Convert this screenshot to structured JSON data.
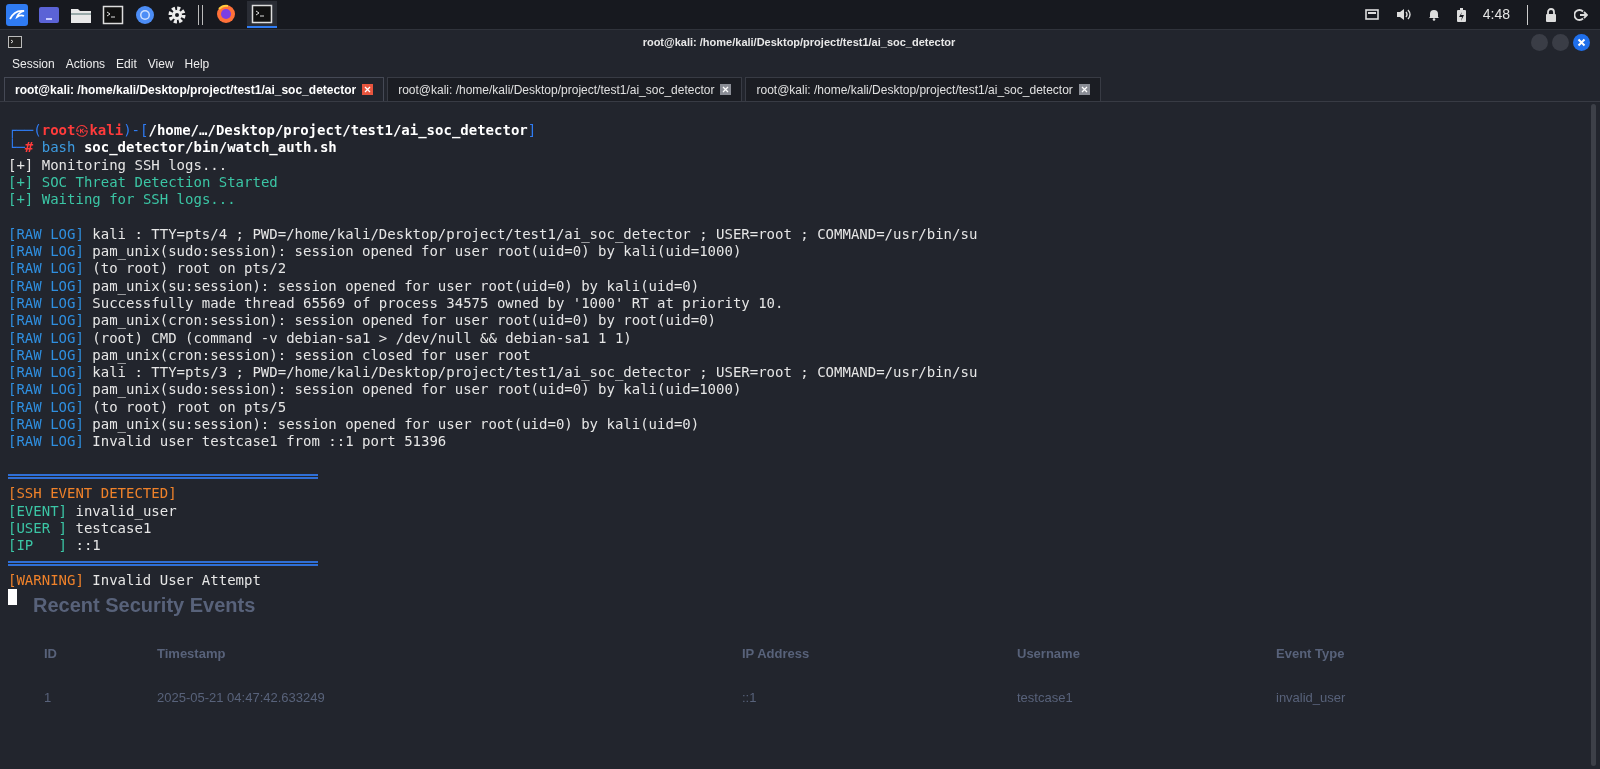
{
  "taskbar": {
    "launchers": [
      {
        "kind": "kali"
      },
      {
        "kind": "workspace"
      },
      {
        "kind": "folder"
      },
      {
        "kind": "terminal"
      },
      {
        "kind": "browser"
      },
      {
        "kind": "gear"
      }
    ],
    "apps": [
      {
        "kind": "firefox",
        "selected": false
      },
      {
        "kind": "terminal",
        "selected": true
      }
    ],
    "time": "4:48"
  },
  "window": {
    "title": "root@kali: /home/kali/Desktop/project/test1/ai_soc_detector",
    "menu": [
      "Session",
      "Actions",
      "Edit",
      "View",
      "Help"
    ],
    "tabs": [
      {
        "label": "root@kali: /home/kali/Desktop/project/test1/ai_soc_detector",
        "selected": true
      },
      {
        "label": "root@kali: /home/kali/Desktop/project/test1/ai_soc_detector",
        "selected": false
      },
      {
        "label": "root@kali: /home/kali/Desktop/project/test1/ai_soc_detector",
        "selected": false
      }
    ]
  },
  "background_page": {
    "title": "Recent Security Events",
    "columns": [
      "ID",
      "Timestamp",
      "IP Address",
      "Username",
      "Event Type"
    ],
    "rows": [
      [
        "1",
        "2025-05-21 04:47:42.633249",
        "::1",
        "testcase1",
        "invalid_user"
      ]
    ]
  },
  "terminal": {
    "lines": [
      {
        "kind": "prompt",
        "open": "┌──(",
        "user": "root",
        "symbol": "㉿",
        "host": "kali",
        "mid": ")-[",
        "path": "/home/…/Desktop/project/test1/ai_soc_detector",
        "close": "]"
      },
      {
        "kind": "command",
        "lead": "└─",
        "hash": "#",
        "program": "bash",
        "args": "soc_detector/bin/watch_auth.sh"
      },
      {
        "kind": "note",
        "tag": "[+]",
        "text": "Monitoring SSH logs..."
      },
      {
        "kind": "ok",
        "tag": "[+]",
        "text": "SOC Threat Detection Started"
      },
      {
        "kind": "ok",
        "tag": "[+]",
        "text": "Waiting for SSH logs..."
      },
      {
        "kind": "blank"
      },
      {
        "kind": "raw",
        "tag": "[RAW LOG]",
        "text": "kali : TTY=pts/4 ; PWD=/home/kali/Desktop/project/test1/ai_soc_detector ; USER=root ; COMMAND=/usr/bin/su"
      },
      {
        "kind": "raw",
        "tag": "[RAW LOG]",
        "text": "pam_unix(sudo:session): session opened for user root(uid=0) by kali(uid=1000)"
      },
      {
        "kind": "raw",
        "tag": "[RAW LOG]",
        "text": "(to root) root on pts/2"
      },
      {
        "kind": "raw",
        "tag": "[RAW LOG]",
        "text": "pam_unix(su:session): session opened for user root(uid=0) by kali(uid=0)"
      },
      {
        "kind": "raw",
        "tag": "[RAW LOG]",
        "text": "Successfully made thread 65569 of process 34575 owned by '1000' RT at priority 10."
      },
      {
        "kind": "raw",
        "tag": "[RAW LOG]",
        "text": "pam_unix(cron:session): session opened for user root(uid=0) by root(uid=0)"
      },
      {
        "kind": "raw",
        "tag": "[RAW LOG]",
        "text": "(root) CMD (command -v debian-sa1 > /dev/null && debian-sa1 1 1)"
      },
      {
        "kind": "raw",
        "tag": "[RAW LOG]",
        "text": "pam_unix(cron:session): session closed for user root"
      },
      {
        "kind": "raw",
        "tag": "[RAW LOG]",
        "text": "kali : TTY=pts/3 ; PWD=/home/kali/Desktop/project/test1/ai_soc_detector ; USER=root ; COMMAND=/usr/bin/su"
      },
      {
        "kind": "raw",
        "tag": "[RAW LOG]",
        "text": "pam_unix(sudo:session): session opened for user root(uid=0) by kali(uid=1000)"
      },
      {
        "kind": "raw",
        "tag": "[RAW LOG]",
        "text": "(to root) root on pts/5"
      },
      {
        "kind": "raw",
        "tag": "[RAW LOG]",
        "text": "pam_unix(su:session): session opened for user root(uid=0) by kali(uid=0)"
      },
      {
        "kind": "raw",
        "tag": "[RAW LOG]",
        "text": "Invalid user testcase1 from ::1 port 51396"
      },
      {
        "kind": "blank"
      },
      {
        "kind": "rule"
      },
      {
        "kind": "alert",
        "text": "[SSH EVENT DETECTED]"
      },
      {
        "kind": "field",
        "tag": "[EVENT]",
        "text": "invalid_user"
      },
      {
        "kind": "field",
        "tag": "[USER ]",
        "text": "testcase1"
      },
      {
        "kind": "field",
        "tag": "[IP   ]",
        "text": "::1"
      },
      {
        "kind": "rule"
      },
      {
        "kind": "warning",
        "tag": "[WARNING]",
        "text": "Invalid User Attempt"
      },
      {
        "kind": "cursor"
      }
    ]
  }
}
